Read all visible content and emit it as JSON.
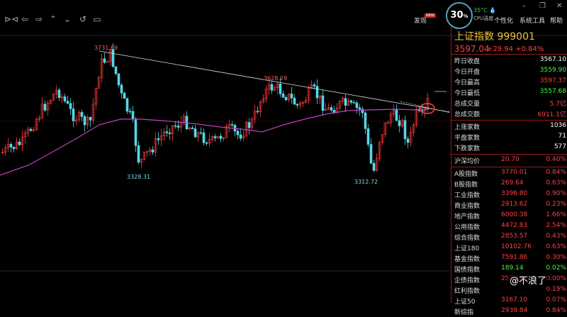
{
  "toolbar": {
    "menu_items": [
      "发现",
      "个性化",
      "系统工具",
      "帮助"
    ],
    "badge": "NEW",
    "cpu_percent": "30",
    "cpu_percent_suffix": "%",
    "cpu_temp": "35°C",
    "cpu_label": "CPU温度"
  },
  "chart_data": {
    "type": "candlestick",
    "annotations": [
      "3731.69",
      "3628.29",
      "3328.31",
      "3312.72"
    ],
    "series": [
      {
        "name": "MA",
        "values": []
      }
    ]
  },
  "panel": {
    "title": "上证指数  999001",
    "price": "3597.04",
    "change": "+29.94  +0.84%",
    "stats": [
      {
        "label": "昨日收盘",
        "value": "3567.10",
        "color": "white"
      },
      {
        "label": "今日开盘",
        "value": "3559.90",
        "color": "green"
      },
      {
        "label": "今日最高",
        "value": "3597.37",
        "color": "red"
      },
      {
        "label": "今日最低",
        "value": "3557.68",
        "color": "green"
      },
      {
        "label": "总成交量",
        "value": "5.7亿",
        "color": "red"
      },
      {
        "label": "总成交额",
        "value": "6911.1亿",
        "color": "red"
      }
    ],
    "counts": [
      {
        "label": "上涨家数",
        "value": "1036",
        "color": "white"
      },
      {
        "label": "平盘家数",
        "value": "71",
        "color": "white"
      },
      {
        "label": "下跌家数",
        "value": "577",
        "color": "white"
      }
    ],
    "avg": {
      "label": "沪深均价",
      "value": "20.70",
      "pct": "0.40%"
    },
    "indices": [
      {
        "label": "A股指数",
        "value": "3770.01",
        "pct": "0.84%"
      },
      {
        "label": "B股指数",
        "value": "269.64",
        "pct": "0.63%"
      },
      {
        "label": "工业指数",
        "value": "3396.80",
        "pct": "0.90%"
      },
      {
        "label": "商业指数",
        "value": "2913.62",
        "pct": "0.23%"
      },
      {
        "label": "地产指数",
        "value": "6000.38",
        "pct": "1.66%"
      },
      {
        "label": "公用指数",
        "value": "4472.83",
        "pct": "2.54%"
      },
      {
        "label": "综合指数",
        "value": "2853.57",
        "pct": "0.43%"
      },
      {
        "label": "上证180",
        "value": "10102.76",
        "pct": "0.63%"
      },
      {
        "label": "基金指数",
        "value": "7591.86",
        "pct": "0.30%"
      },
      {
        "label": "国债指数",
        "value": "189.14",
        "pct": "0.02%"
      },
      {
        "label": "企债指数",
        "value": "257.18",
        "pct": "0.00%"
      },
      {
        "label": "红利指数",
        "value": "",
        "pct": "0.19%"
      },
      {
        "label": "上证50",
        "value": "3167.10",
        "pct": "0.07%"
      },
      {
        "label": "新综指",
        "value": "2939.84",
        "pct": "0.84%"
      }
    ]
  },
  "watermark": "@不浪了"
}
